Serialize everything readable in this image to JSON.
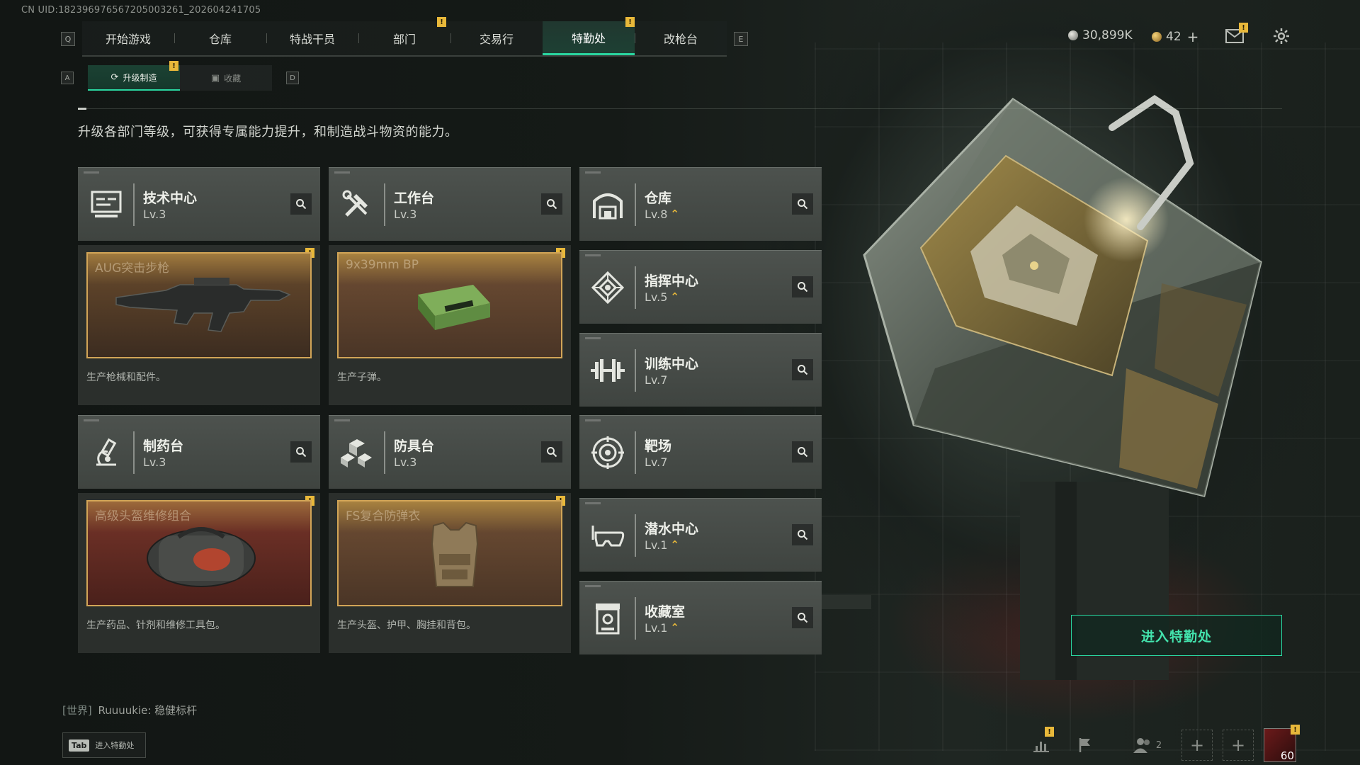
{
  "uid": "CN UID:18239697656720500326​1_202604241705",
  "topnav": {
    "left_key": "Q",
    "right_key": "E",
    "tabs": [
      {
        "label": "开始游戏"
      },
      {
        "label": "仓库"
      },
      {
        "label": "特战干员"
      },
      {
        "label": "部门"
      },
      {
        "label": "交易行"
      },
      {
        "label": "特勤处"
      },
      {
        "label": "改枪台"
      }
    ],
    "active_tab": "特勤处"
  },
  "subnav": {
    "left_key": "A",
    "right_key": "D",
    "tabs": [
      {
        "label": "升级制造",
        "icon": "upgrade-icon"
      },
      {
        "label": "收藏",
        "icon": "collection-icon"
      }
    ]
  },
  "currency": {
    "coins": "30,899K",
    "premium": "42",
    "plus": "+"
  },
  "description": "升级各部门等级，可获得专属能力提升，和制造战斗物资的能力。",
  "departments": [
    {
      "name": "技术中心",
      "level": "Lv.3",
      "icon": "tech-center-icon",
      "upgradable": false
    },
    {
      "name": "工作台",
      "level": "Lv.3",
      "icon": "workbench-icon",
      "upgradable": false
    },
    {
      "name": "仓库",
      "level": "Lv.8",
      "icon": "warehouse-icon",
      "upgradable": true
    },
    {
      "name": "指挥中心",
      "level": "Lv.5",
      "icon": "command-center-icon",
      "upgradable": true
    },
    {
      "name": "训练中心",
      "level": "Lv.7",
      "icon": "training-center-icon",
      "upgradable": false
    },
    {
      "name": "制药台",
      "level": "Lv.3",
      "icon": "pharmacy-icon",
      "upgradable": false
    },
    {
      "name": "防具台",
      "level": "Lv.3",
      "icon": "armor-bench-icon",
      "upgradable": false
    },
    {
      "name": "靶场",
      "level": "Lv.7",
      "icon": "shooting-range-icon",
      "upgradable": false
    },
    {
      "name": "潜水中心",
      "level": "Lv.1",
      "icon": "diving-center-icon",
      "upgradable": true
    },
    {
      "name": "收藏室",
      "level": "Lv.1",
      "icon": "collection-room-icon",
      "upgradable": true
    }
  ],
  "productions": [
    {
      "title": "AUG突击步枪",
      "desc": "生产枪械和配件。"
    },
    {
      "title": "9x39mm BP",
      "desc": "生产子弹。"
    },
    {
      "title": "高级头盔维修组合",
      "desc": "生产药品、针剂和维修工具包。"
    },
    {
      "title": "FS复合防弹衣",
      "desc": "生产头盔、护甲、胸挂和背包。"
    }
  ],
  "enter_button": "进入特勤处",
  "chat": {
    "channel": "[世界]",
    "message": "Ruuuukie: 稳健标杆"
  },
  "tab_hint": {
    "key": "Tab",
    "label": "进入特勤处"
  },
  "bottom": {
    "friends_count": "2",
    "player_level": "60"
  },
  "colors": {
    "accent": "#2ad6a0",
    "badge": "#e8b83a",
    "frame": "#d2a557"
  }
}
